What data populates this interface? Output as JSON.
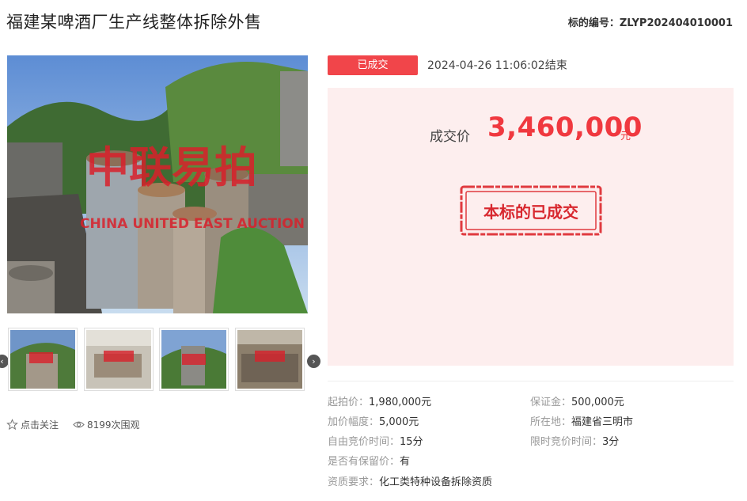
{
  "header": {
    "title": "福建某啤酒厂生产线整体拆除外售",
    "lot_label": "标的编号：",
    "lot_number": "ZLYP202404010001"
  },
  "gallery": {
    "watermark_cn": "中联易拍",
    "watermark_en": "CHINA UNITED EAST AUCTION",
    "thumbnail_count": 4
  },
  "actions": {
    "follow_label": "点击关注",
    "views_label": "8199次围观"
  },
  "status": {
    "badge": "已成交",
    "end_time": "2024-04-26 11:06:02结束"
  },
  "price": {
    "label": "成交价",
    "value": "3,460,000",
    "unit": "元",
    "stamp_text": "本标的已成交"
  },
  "details": {
    "start_price_label": "起拍价：",
    "start_price": "1,980,000元",
    "deposit_label": "保证金：",
    "deposit": "500,000元",
    "increment_label": "加价幅度：",
    "increment": "5,000元",
    "location_label": "所在地：",
    "location": "福建省三明市",
    "free_bid_label": "自由竞价时间：",
    "free_bid": "15分",
    "limited_bid_label": "限时竞价时间：",
    "limited_bid": "3分",
    "reserve_label": "是否有保留价：",
    "reserve": "有",
    "qualification_label": "资质要求：",
    "qualification": "化工类特种设备拆除资质"
  },
  "colors": {
    "accent_red": "#f0383f",
    "badge_red": "#f1454a",
    "panel_pink": "#fdeeee"
  }
}
